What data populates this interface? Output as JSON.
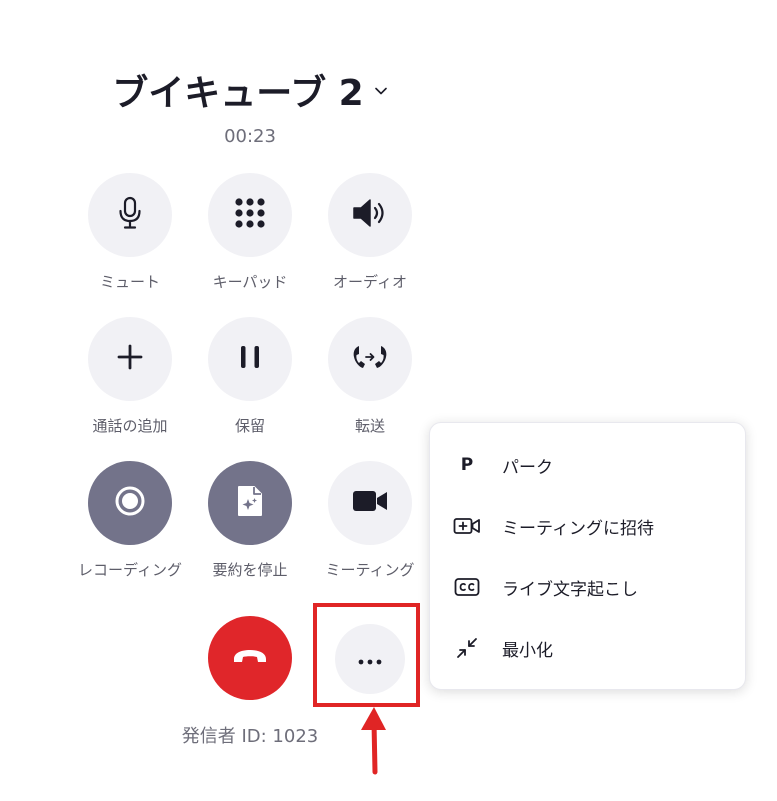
{
  "call": {
    "title": "ブイキューブ 2",
    "timer": "00:23",
    "caller_id": "発信者 ID: 1023"
  },
  "controls": [
    {
      "label": "ミュート",
      "icon": "microphone-icon"
    },
    {
      "label": "キーパッド",
      "icon": "keypad-icon"
    },
    {
      "label": "オーディオ",
      "icon": "speaker-icon"
    },
    {
      "label": "通話の追加",
      "icon": "plus-icon"
    },
    {
      "label": "保留",
      "icon": "pause-icon"
    },
    {
      "label": "転送",
      "icon": "transfer-icon"
    },
    {
      "label": "レコーディング",
      "icon": "record-icon"
    },
    {
      "label": "要約を停止",
      "icon": "ai-summary-icon"
    },
    {
      "label": "ミーティング",
      "icon": "video-camera-icon"
    }
  ],
  "menu": {
    "items": [
      {
        "icon_text": "P",
        "label": "パーク",
        "icon": "park-icon"
      },
      {
        "label": "ミーティングに招待",
        "icon": "invite-video-icon"
      },
      {
        "label": "ライブ文字起こし",
        "icon": "closed-caption-icon"
      },
      {
        "label": "最小化",
        "icon": "minimize-icon"
      }
    ]
  },
  "colors": {
    "end_call": "#e0262a",
    "highlight": "#e02525",
    "control_bg": "#f1f1f5",
    "control_active_bg": "#73738a"
  }
}
